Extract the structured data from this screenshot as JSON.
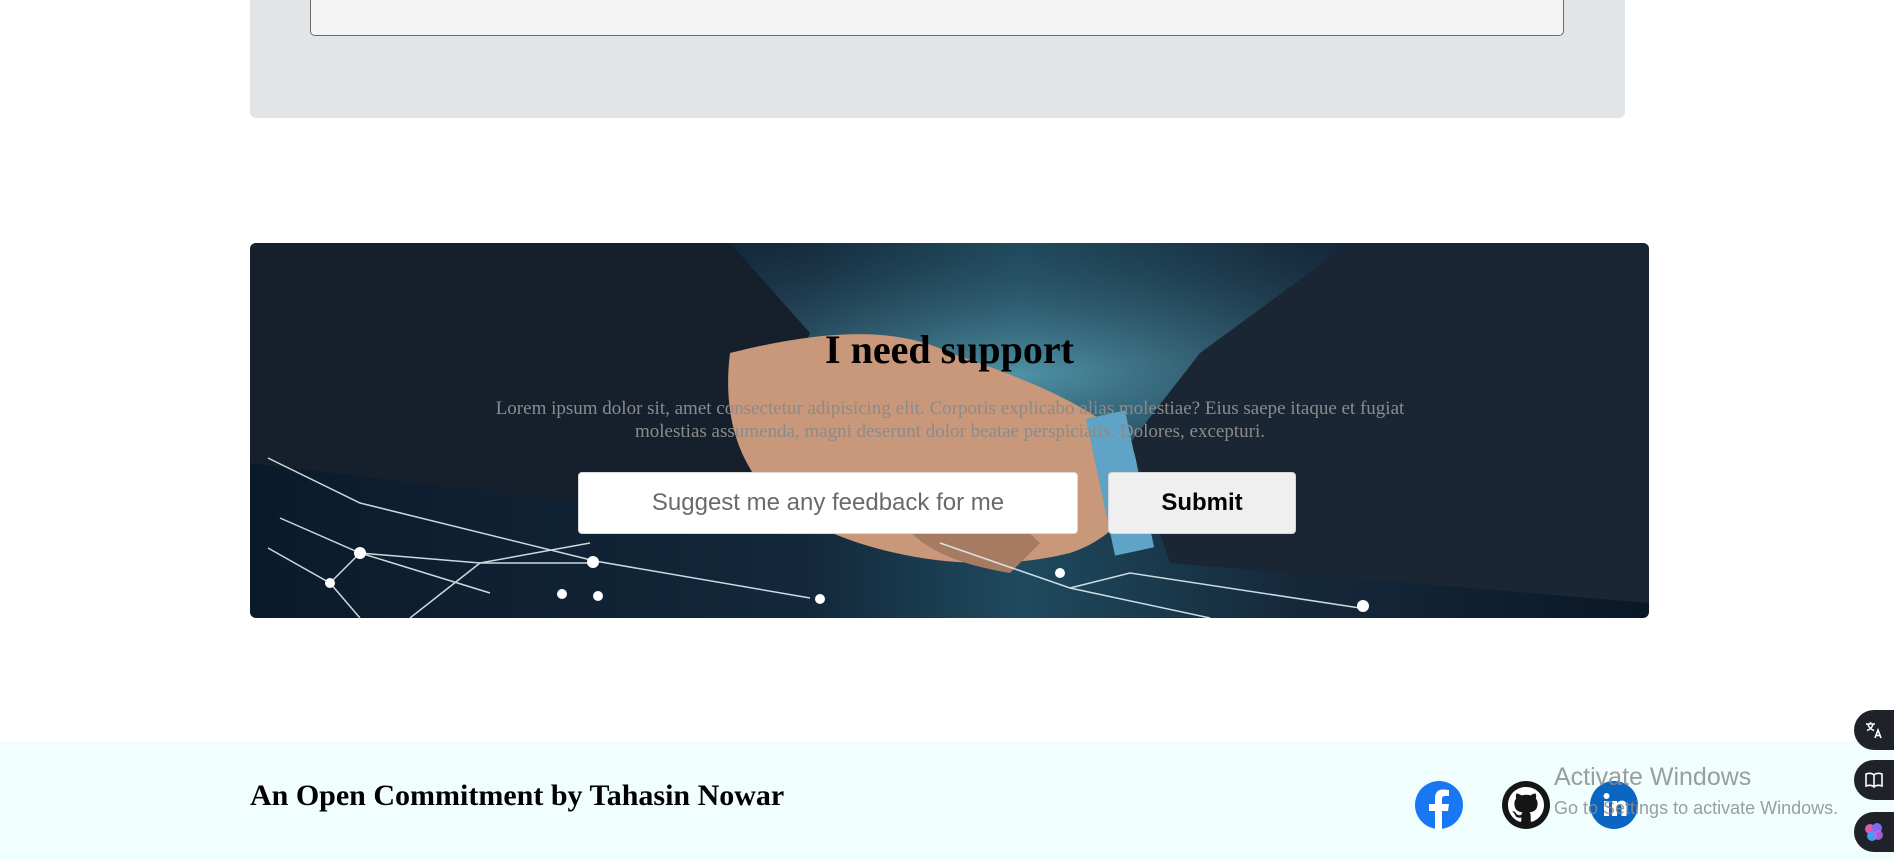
{
  "support": {
    "title": "I need support",
    "description": "Lorem ipsum dolor sit, amet consectetur adipisicing elit. Corporis explicabo alias molestiae? Eius saepe itaque et fugiat molestias assumenda, magni deserunt dolor beatae perspiciatis. Dolores, excepturi.",
    "input_placeholder": "Suggest me any feedback for me",
    "submit_label": "Submit"
  },
  "footer": {
    "title": "An Open Commitment by Tahasin Nowar",
    "social_icons": [
      "facebook-icon",
      "github-icon",
      "linkedin-icon"
    ]
  },
  "watermark": {
    "line1": "Activate Windows",
    "line2": "Go to Settings to activate Windows."
  },
  "side_buttons": [
    "translate-icon",
    "book-icon",
    "brain-icon"
  ],
  "colors": {
    "facebook": "#1877f2",
    "linkedin": "#0a66c2",
    "footer_bg": "#f0fefe",
    "panel_bg": "#e2e5e7"
  }
}
